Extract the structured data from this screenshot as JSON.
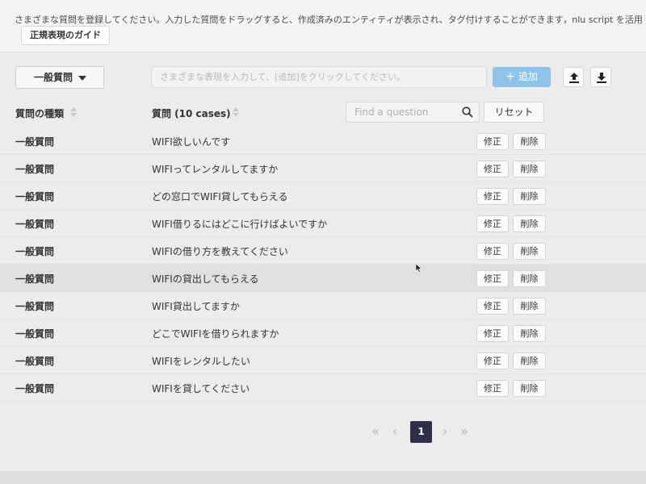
{
  "header": {
    "instruction": "さまざまな質問を登録してください。入力した質問をドラッグすると、作成済みのエンティティが表示され、タグ付けすることができます，nlu script を活用",
    "regex_guide_label": "正規表現のガイド"
  },
  "toolbar": {
    "type_select_value": "一般質問",
    "expression_placeholder": "さまざまな表現を入力して、[追加]をクリックしてください。",
    "add_label": "追加",
    "accent_color": "#8fc4ea",
    "upload_icon": "upload-icon",
    "download_icon": "download-icon"
  },
  "table": {
    "col_type_label": "質問の種類",
    "col_question_label": "質問 (10 cases)",
    "search_placeholder": "Find a question",
    "reset_label": "リセット",
    "edit_label": "修正",
    "delete_label": "削除",
    "rows": [
      {
        "type": "一般質問",
        "question": "WIFI欲しいんです"
      },
      {
        "type": "一般質問",
        "question": "WIFIってレンタルしてますか"
      },
      {
        "type": "一般質問",
        "question": "どの窓口でWIFI貸してもらえる"
      },
      {
        "type": "一般質問",
        "question": "WIFI借りるにはどこに行けばよいですか"
      },
      {
        "type": "一般質問",
        "question": "WIFIの借り方を教えてください"
      },
      {
        "type": "一般質問",
        "question": "WIFIの貸出してもらえる"
      },
      {
        "type": "一般質問",
        "question": "WIFI貸出してますか"
      },
      {
        "type": "一般質問",
        "question": "どこでWIFIを借りられますか"
      },
      {
        "type": "一般質問",
        "question": "WIFIをレンタルしたい"
      },
      {
        "type": "一般質問",
        "question": "WIFIを貸してください"
      }
    ]
  },
  "pagination": {
    "first": "«",
    "prev": "‹",
    "current": "1",
    "next": "›",
    "last": "»",
    "current_color": "#2f2f4a"
  }
}
